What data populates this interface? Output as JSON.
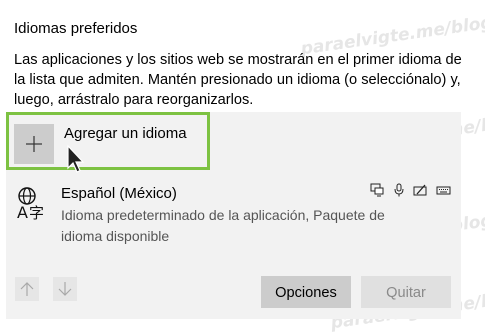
{
  "section": {
    "title": "Idiomas preferidos",
    "description": "Las aplicaciones y los sitios web se mostrarán en el primer idioma de la lista que admiten. Mantén presionado un idioma (o selecciónalo) y, luego, arrástralo para reorganizarlos."
  },
  "add_language": {
    "label": "Agregar un idioma",
    "icon": "plus-icon"
  },
  "languages": [
    {
      "name": "Español (México)",
      "detail": "Idioma predeterminado de la aplicación, Paquete de idioma disponible",
      "icon": "language-icon",
      "feature_icons": [
        "display-icon",
        "microphone-icon",
        "handwriting-icon",
        "keyboard-icon"
      ]
    }
  ],
  "buttons": {
    "options": "Opciones",
    "remove": "Quitar"
  },
  "watermark": "paraelvigte.me/blog",
  "colors": {
    "highlight": "#7dc242",
    "panel": "#f2f2f2",
    "button": "#cccccc"
  }
}
